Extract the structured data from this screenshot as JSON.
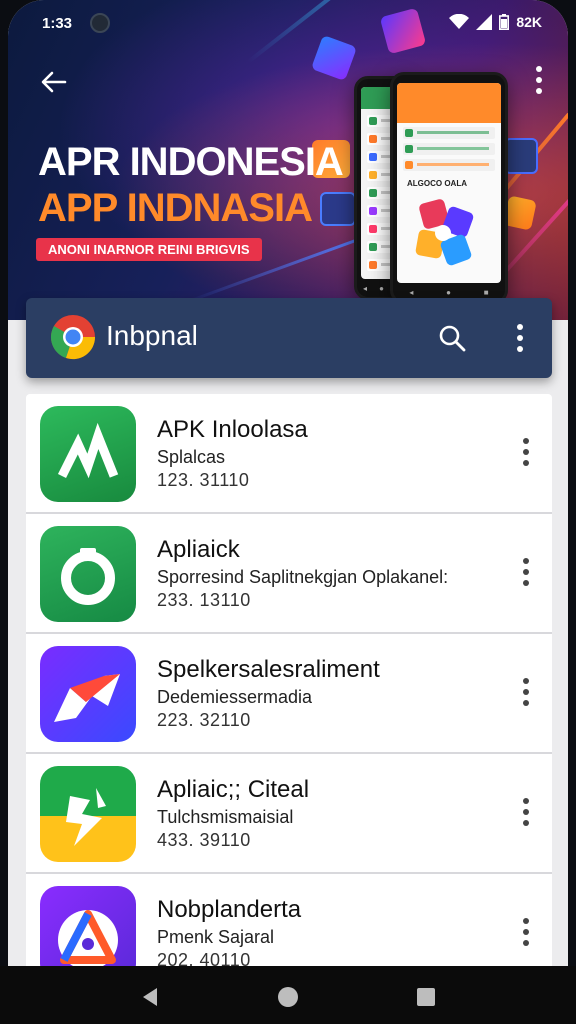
{
  "status_bar": {
    "time": "1:33",
    "battery": "82K",
    "icons": [
      "wifi-icon",
      "signal-icon",
      "battery-icon"
    ]
  },
  "hero": {
    "title_line1": "APR INDONESIA",
    "title_line2": "APP INDNASIA",
    "tagline": "ANONI INARNOR REINI BRIGVIS",
    "phone_label": "ALGOCO OALA",
    "colors": {
      "title_accent": "#ff8a2a",
      "tag_bg": "#e8334a"
    }
  },
  "app_bar": {
    "title": "Inbpnal",
    "logo": "chrome-logo-icon",
    "search_icon": "search-icon",
    "menu_icon": "more-vert-icon",
    "color": "#2b3e63"
  },
  "apps": [
    {
      "name": "APK Inloolasa",
      "subtitle": "Splalcas",
      "version": "123. 31110",
      "icon": "green-chart-icon"
    },
    {
      "name": "Apliaick",
      "subtitle": "Sporresind Saplitnekgjan Oplakanel:",
      "version": "233. 13110",
      "icon": "green-ring-icon"
    },
    {
      "name": "Spelkersalesraliment",
      "subtitle": "Dedemiessermadia",
      "version": "223. 32110",
      "icon": "purple-arrow-icon"
    },
    {
      "name": "Apliaic;; Citeal",
      "subtitle": "Tulchsmismaisial",
      "version": "433. 39110",
      "icon": "green-yellow-bolt-icon"
    },
    {
      "name": "Nobplanderta",
      "subtitle": "Pmenk Sajaral",
      "version": "202. 40110",
      "icon": "purple-triangle-icon"
    }
  ],
  "nav_bar": {
    "buttons": [
      "back-nav-icon",
      "home-nav-icon",
      "recents-nav-icon"
    ]
  }
}
